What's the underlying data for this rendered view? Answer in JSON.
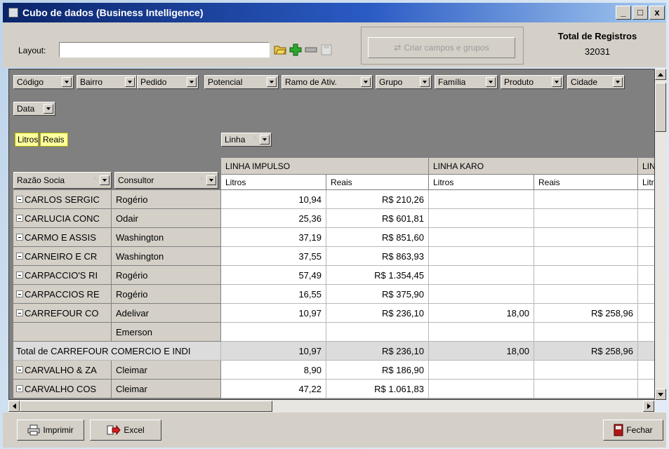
{
  "window": {
    "title": "Cubo de dados (Business Intelligence)",
    "controls": {
      "minimize": "_",
      "maximize": "□",
      "close": "x"
    }
  },
  "toolbar": {
    "layout_label": "Layout:",
    "layout_value": "",
    "icons": [
      "open-folder-icon",
      "add-icon",
      "remove-icon",
      "disabled-save-icon"
    ],
    "criar_label": "Criar campos e grupos",
    "registros_label": "Total de Registros",
    "registros_value": "32031"
  },
  "filter_fields": [
    "Código",
    "Bairro",
    "Pedido",
    "Potencial",
    "Ramo de Ativ.",
    "Grupo",
    "Família",
    "Produto",
    "Cidade",
    "Data"
  ],
  "data_fields": [
    "Litros",
    "Reais"
  ],
  "column_field": {
    "label": "Linha",
    "sort": "^"
  },
  "row_fields": [
    {
      "label": "Razão Socia",
      "sort": "^"
    },
    {
      "label": "Consultor",
      "sort": "^"
    }
  ],
  "column_groups": [
    "LINHA IMPULSO",
    "LINHA KARO",
    "LIN"
  ],
  "measure_headers": [
    "Litros",
    "Reais",
    "Litros",
    "Reais",
    "Litr"
  ],
  "rows": [
    {
      "razao": "CARLOS SERGIC",
      "consultor": "Rogério",
      "values": [
        "10,94",
        "R$ 210,26",
        "",
        ""
      ],
      "expand": true
    },
    {
      "razao": "CARLUCIA CONC",
      "consultor": "Odair",
      "values": [
        "25,36",
        "R$ 601,81",
        "",
        ""
      ],
      "expand": true
    },
    {
      "razao": "CARMO E ASSIS",
      "consultor": "Washington",
      "values": [
        "37,19",
        "R$ 851,60",
        "",
        ""
      ],
      "expand": true
    },
    {
      "razao": "CARNEIRO E CR",
      "consultor": "Washington",
      "values": [
        "37,55",
        "R$ 863,93",
        "",
        ""
      ],
      "expand": true
    },
    {
      "razao": "CARPACCIO'S RI",
      "consultor": "Rogério",
      "values": [
        "57,49",
        "R$ 1.354,45",
        "",
        ""
      ],
      "expand": true
    },
    {
      "razao": "CARPACCIOS RE",
      "consultor": "Rogério",
      "values": [
        "16,55",
        "R$ 375,90",
        "",
        ""
      ],
      "expand": true
    },
    {
      "razao": "CARREFOUR CO",
      "consultor": "Adelivar",
      "values": [
        "10,97",
        "R$ 236,10",
        "18,00",
        "R$ 258,96"
      ],
      "expand": true
    },
    {
      "razao": "",
      "consultor": "Emerson",
      "values": [
        "",
        "",
        "",
        ""
      ],
      "expand": false
    }
  ],
  "total_row": {
    "label": "Total de CARREFOUR COMERCIO E INDI",
    "values": [
      "10,97",
      "R$ 236,10",
      "18,00",
      "R$ 258,96"
    ]
  },
  "rows_after": [
    {
      "razao": "CARVALHO & ZA",
      "consultor": "Cleimar",
      "values": [
        "8,90",
        "R$ 186,90",
        "",
        ""
      ],
      "expand": true
    },
    {
      "razao": "CARVALHO COS",
      "consultor": "Cleimar",
      "values": [
        "47,22",
        "R$ 1.061,83",
        "",
        ""
      ],
      "expand": true
    }
  ],
  "footer": {
    "print_label": "Imprimir",
    "excel_label": "Excel",
    "close_label": "Fechar"
  }
}
